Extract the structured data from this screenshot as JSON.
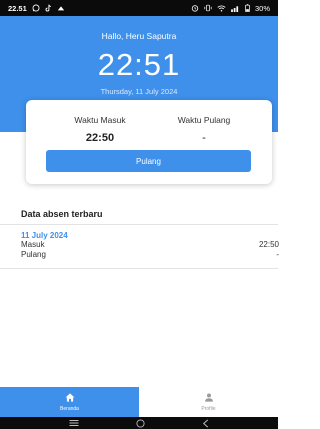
{
  "status_bar": {
    "time": "22.51",
    "battery": "30%",
    "left_icons": [
      "whatsapp-icon",
      "tiktok-icon",
      "cloud-icon"
    ],
    "right_icons": [
      "alarm-icon",
      "vibrate-icon",
      "wifi-icon",
      "signal-icon",
      "battery-icon"
    ]
  },
  "header": {
    "greeting": "Hallo, Heru Saputra",
    "clock": "22:51",
    "date": "Thursday, 11 July 2024"
  },
  "attendance_card": {
    "masuk_label": "Waktu Masuk",
    "masuk_value": "22:50",
    "pulang_label": "Waktu Pulang",
    "pulang_value": "-",
    "button_label": "Pulang"
  },
  "recent": {
    "title": "Data absen terbaru",
    "records": [
      {
        "date": "11 July 2024",
        "rows": [
          {
            "label": "Masuk",
            "value": "22:50"
          },
          {
            "label": "Pulang",
            "value": "-"
          }
        ]
      }
    ]
  },
  "bottom_nav": {
    "items": [
      {
        "label": "Beranda",
        "icon": "home-icon",
        "active": true
      },
      {
        "label": "Profile",
        "icon": "person-icon",
        "active": false
      }
    ]
  },
  "colors": {
    "primary": "#3e90ea",
    "status_bar": "#0b0b0b"
  }
}
